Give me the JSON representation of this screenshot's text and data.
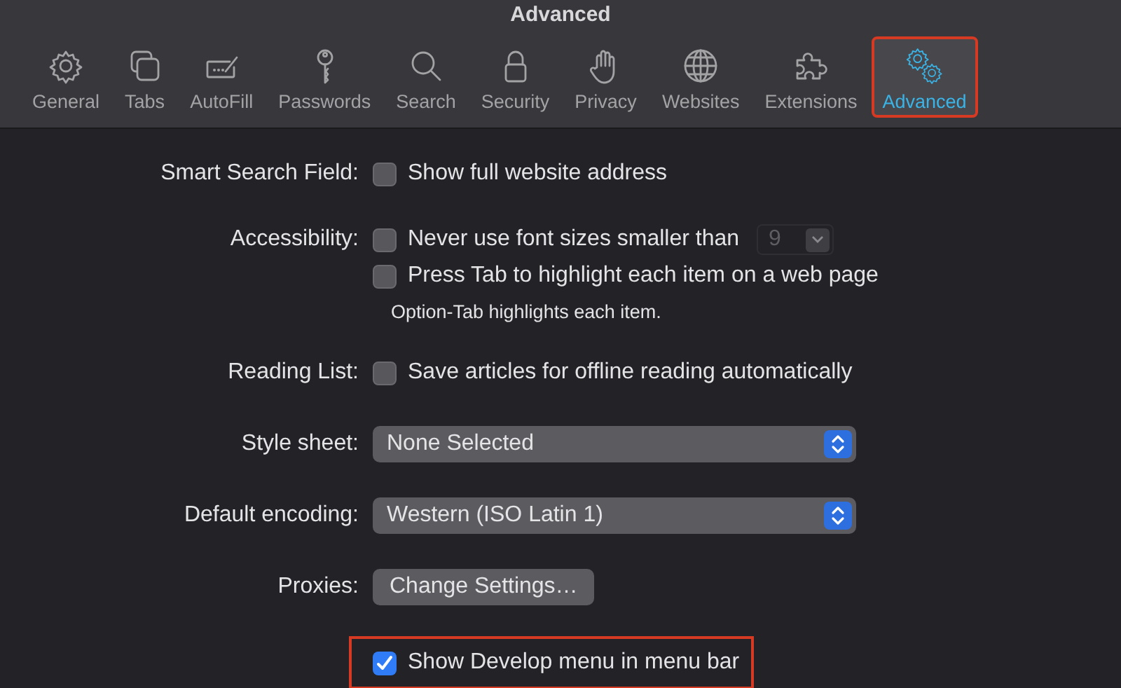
{
  "window": {
    "title": "Advanced"
  },
  "toolbar": {
    "tabs": [
      {
        "label": "General",
        "selected": false,
        "annotated": false
      },
      {
        "label": "Tabs",
        "selected": false,
        "annotated": false
      },
      {
        "label": "AutoFill",
        "selected": false,
        "annotated": false
      },
      {
        "label": "Passwords",
        "selected": false,
        "annotated": false
      },
      {
        "label": "Search",
        "selected": false,
        "annotated": false
      },
      {
        "label": "Security",
        "selected": false,
        "annotated": false
      },
      {
        "label": "Privacy",
        "selected": false,
        "annotated": false
      },
      {
        "label": "Websites",
        "selected": false,
        "annotated": false
      },
      {
        "label": "Extensions",
        "selected": false,
        "annotated": false
      },
      {
        "label": "Advanced",
        "selected": true,
        "annotated": true
      }
    ]
  },
  "settings": [
    {
      "label": "Smart Search Field:",
      "kind": "checkbox",
      "text": "Show full website address",
      "checked": false,
      "annotated": false
    },
    {
      "label": "Accessibility:",
      "kind": "checkbox_size",
      "text": "Never use font sizes smaller than",
      "checked": false,
      "size": "9",
      "size_disabled": true,
      "annotated": false
    },
    {
      "kind": "checkbox",
      "text": "Press Tab to highlight each item on a web page",
      "checked": false,
      "annotated": false
    },
    {
      "kind": "note",
      "text": "Option-Tab highlights each item."
    },
    {
      "label": "Reading List:",
      "kind": "checkbox",
      "text": "Save articles for offline reading automatically",
      "checked": false,
      "annotated": false
    },
    {
      "label": "Style sheet:",
      "kind": "popup",
      "value": "None Selected"
    },
    {
      "label": "Default encoding:",
      "kind": "popup",
      "value": "Western (ISO Latin 1)"
    },
    {
      "label": "Proxies:",
      "kind": "button",
      "text": "Change Settings…"
    },
    {
      "kind": "checkbox",
      "text": "Show Develop menu in menu bar",
      "checked": true,
      "annotated": true
    }
  ]
}
